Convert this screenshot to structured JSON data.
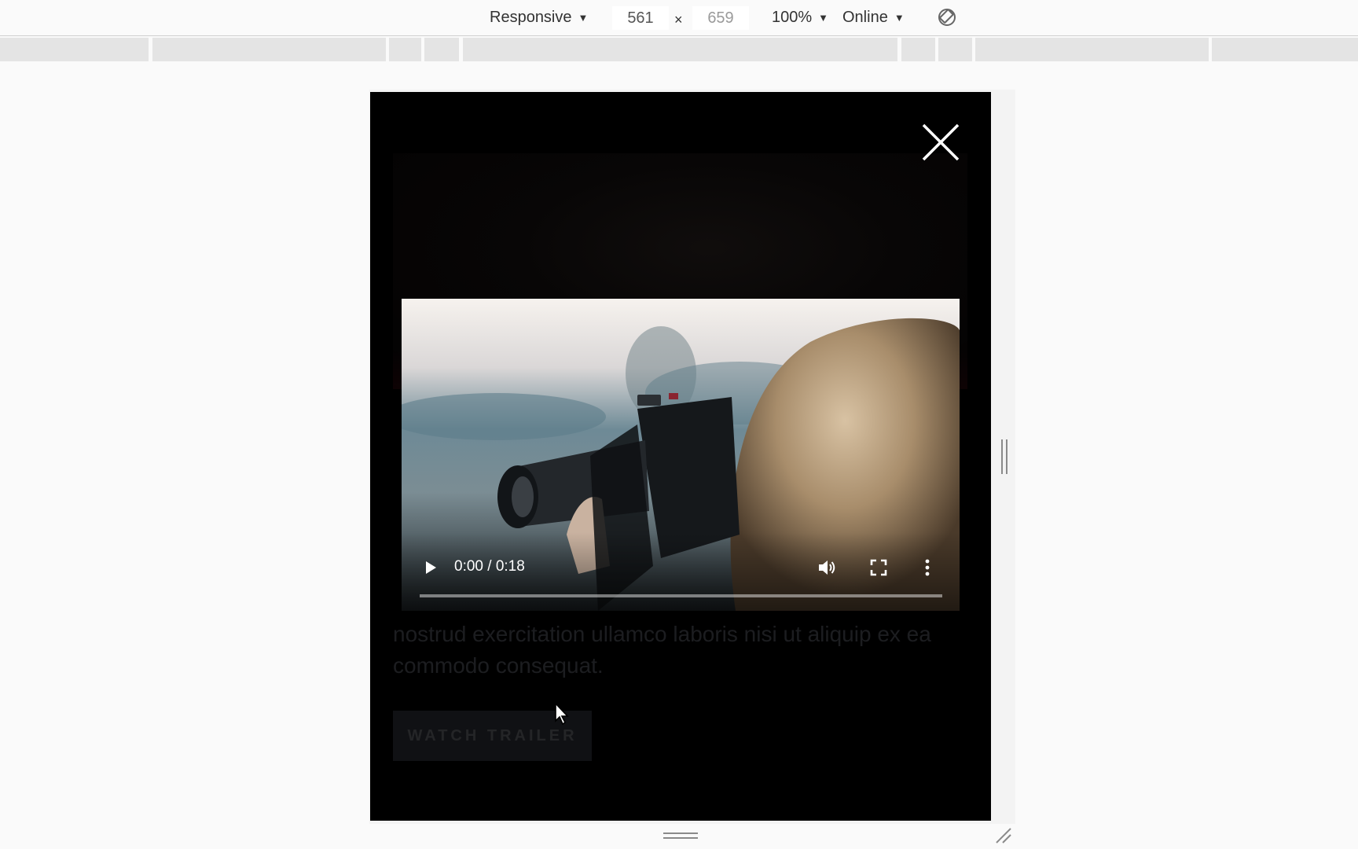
{
  "toolbar": {
    "device": "Responsive",
    "width": "561",
    "height": "659",
    "times": "×",
    "zoom": "100%",
    "network": "Online",
    "rotate_icon": "rotate-icon",
    "caret_icon": "caret-down-icon"
  },
  "page": {
    "hero_image": "dim-hero-image",
    "body_text": "nostrud exercitation ullamco laboris nisi ut aliquip ex ea commodo consequat.",
    "button_label": "WATCH TRAILER"
  },
  "modal": {
    "close_icon": "close-icon"
  },
  "video": {
    "poster": "photographer-with-camera",
    "time": "0:00 / 0:18",
    "progress": 0,
    "play_icon": "play-icon",
    "volume_icon": "volume-icon",
    "fullscreen_icon": "fullscreen-icon",
    "more_icon": "more-vertical-icon"
  },
  "colors": {
    "overlay": "#000000",
    "toolbar_bg": "#fafafa",
    "media_bar": "#e4e4e4"
  }
}
